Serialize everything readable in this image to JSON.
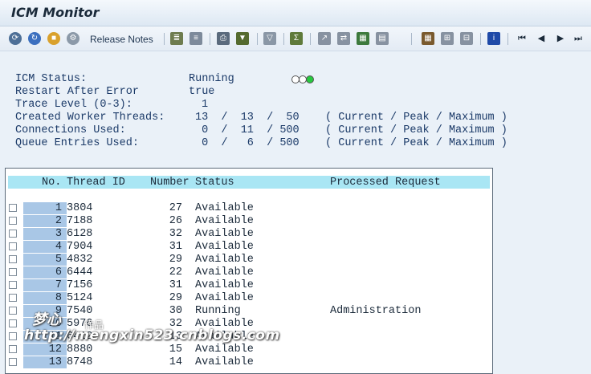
{
  "window": {
    "title": "ICM Monitor"
  },
  "toolbar": {
    "release_notes_label": "Release Notes"
  },
  "status": {
    "icm_status_label": "ICM Status:",
    "icm_status_value": "Running",
    "restart_label": "Restart After Error",
    "restart_value": "true",
    "trace_label": "Trace Level (0-3):",
    "trace_value": "1",
    "threads_label": "Created Worker Threads:",
    "threads_value": "13  /  13  /  50    ( Current / Peak / Maximum )",
    "connections_label": "Connections Used:",
    "connections_value": " 0  /  11  / 500    ( Current / Peak / Maximum )",
    "queue_label": "Queue Entries Used:",
    "queue_value": " 0  /   6  / 500    ( Current / Peak / Maximum )",
    "signal_colors": [
      "#ffffff",
      "#ffffff",
      "#27c93f"
    ]
  },
  "table": {
    "headers": {
      "no": "No.",
      "thread_id": "Thread ID",
      "number": "Number",
      "status": "Status",
      "processed_request": "Processed Request"
    },
    "rows": [
      {
        "no": "1",
        "thread_id": "3804",
        "number": "27",
        "status": "Available",
        "request": ""
      },
      {
        "no": "2",
        "thread_id": "7188",
        "number": "26",
        "status": "Available",
        "request": ""
      },
      {
        "no": "3",
        "thread_id": "6128",
        "number": "32",
        "status": "Available",
        "request": ""
      },
      {
        "no": "4",
        "thread_id": "7904",
        "number": "31",
        "status": "Available",
        "request": ""
      },
      {
        "no": "5",
        "thread_id": "4832",
        "number": "29",
        "status": "Available",
        "request": ""
      },
      {
        "no": "6",
        "thread_id": "6444",
        "number": "22",
        "status": "Available",
        "request": ""
      },
      {
        "no": "7",
        "thread_id": "7156",
        "number": "31",
        "status": "Available",
        "request": ""
      },
      {
        "no": "8",
        "thread_id": "5124",
        "number": "29",
        "status": "Available",
        "request": ""
      },
      {
        "no": "9",
        "thread_id": "7540",
        "number": "30",
        "status": "Running",
        "request": "Administration"
      },
      {
        "no": "10",
        "thread_id": "5976",
        "number": "32",
        "status": "Available",
        "request": ""
      },
      {
        "no": "11",
        "thread_id": "6412",
        "number": "13",
        "status": "Available",
        "request": ""
      },
      {
        "no": "12",
        "thread_id": "8880",
        "number": "15",
        "status": "Available",
        "request": ""
      },
      {
        "no": "13",
        "thread_id": "8748",
        "number": "14",
        "status": "Available",
        "request": ""
      }
    ]
  },
  "watermark": {
    "signature": "梦心",
    "small": "作品",
    "url": "http://mengxin523.cnblogs.com"
  }
}
